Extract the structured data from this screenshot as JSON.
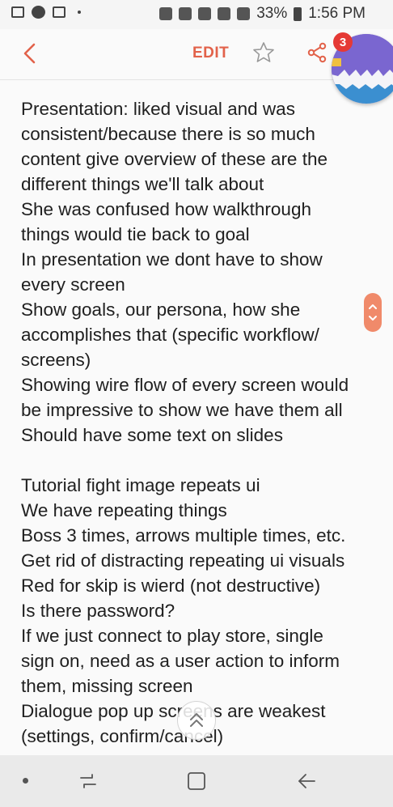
{
  "status_bar": {
    "battery": "33%",
    "time": "1:56 PM",
    "icons": [
      "image-icon",
      "messenger-icon",
      "gmail-icon",
      "dot-icon",
      "android-icon",
      "mute-icon",
      "alarm-icon",
      "wifi-icon",
      "signal-icon",
      "battery-icon"
    ]
  },
  "app_bar": {
    "edit_label": "EDIT",
    "back_icon": "chevron-left-icon",
    "star_icon": "star-outline-icon",
    "share_icon": "share-icon",
    "accent_color": "#e2624a"
  },
  "chat_head": {
    "badge_count": "3"
  },
  "note": {
    "lines": [
      "Presentation: liked visual and was",
      "consistent/because there is so much",
      "content give overview of these are the",
      "different things we'll talk about",
      "She was confused how walkthrough",
      "things would tie back to goal",
      "In presentation we dont have to show",
      "every screen",
      "Show goals, our persona, how she",
      "accomplishes that (specific workflow/",
      "screens)",
      "Showing wire flow of every screen would",
      "be impressive to show we have them all",
      "Should have some text on slides",
      "",
      "Tutorial fight image repeats ui",
      "We have repeating things",
      "Boss 3 times, arrows multiple times, etc.",
      "Get rid of distracting repeating ui  visuals",
      "Red for skip is wierd (not destructive)",
      "Is there password?",
      "If we just connect to play store, single",
      "sign on, need as a user action to inform",
      "them, missing screen",
      "Dialogue pop up screens are weakest",
      "(settings, confirm/cancel)"
    ]
  },
  "nav_bar": {
    "icons": [
      "dot-icon",
      "recent-apps-icon",
      "home-icon",
      "back-icon"
    ]
  }
}
